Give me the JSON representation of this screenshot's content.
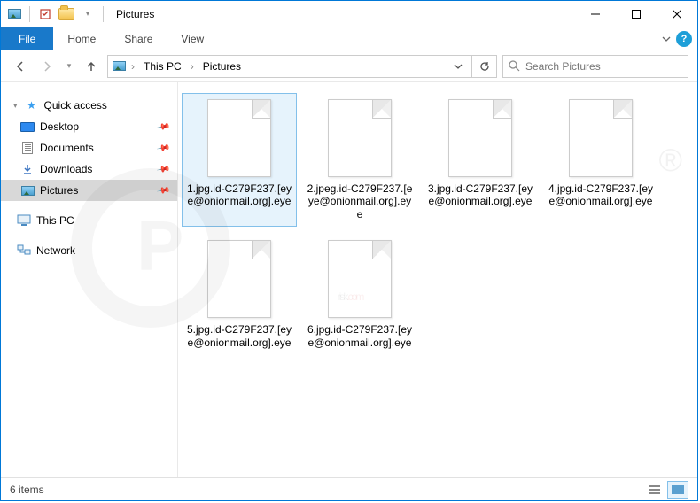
{
  "titlebar": {
    "title": "Pictures"
  },
  "ribbon": {
    "file": "File",
    "tabs": [
      "Home",
      "Share",
      "View"
    ]
  },
  "nav": {
    "crumbs": [
      "This PC",
      "Pictures"
    ]
  },
  "search": {
    "placeholder": "Search Pictures"
  },
  "sidebar": {
    "quick_access": "Quick access",
    "items": [
      {
        "label": "Desktop",
        "icon": "desktop",
        "pinned": true
      },
      {
        "label": "Documents",
        "icon": "doc",
        "pinned": true
      },
      {
        "label": "Downloads",
        "icon": "dl",
        "pinned": true
      },
      {
        "label": "Pictures",
        "icon": "pic",
        "pinned": true,
        "selected": true
      }
    ],
    "this_pc": "This PC",
    "network": "Network"
  },
  "files": [
    {
      "name": "1.jpg.id-C279F237.[eye@onionmail.org].eye",
      "selected": true
    },
    {
      "name": "2.jpeg.id-C279F237.[eye@onionmail.org].eye"
    },
    {
      "name": "3.jpg.id-C279F237.[eye@onionmail.org].eye"
    },
    {
      "name": "4.jpg.id-C279F237.[eye@onionmail.org].eye"
    },
    {
      "name": "5.jpg.id-C279F237.[eye@onionmail.org].eye"
    },
    {
      "name": "6.jpg.id-C279F237.[eye@onionmail.org].eye"
    }
  ],
  "status": {
    "count_text": "6 items"
  },
  "watermark": {
    "brand1": "PC",
    "brand2": "risk",
    "brand3": ".com",
    "reg": "®"
  }
}
